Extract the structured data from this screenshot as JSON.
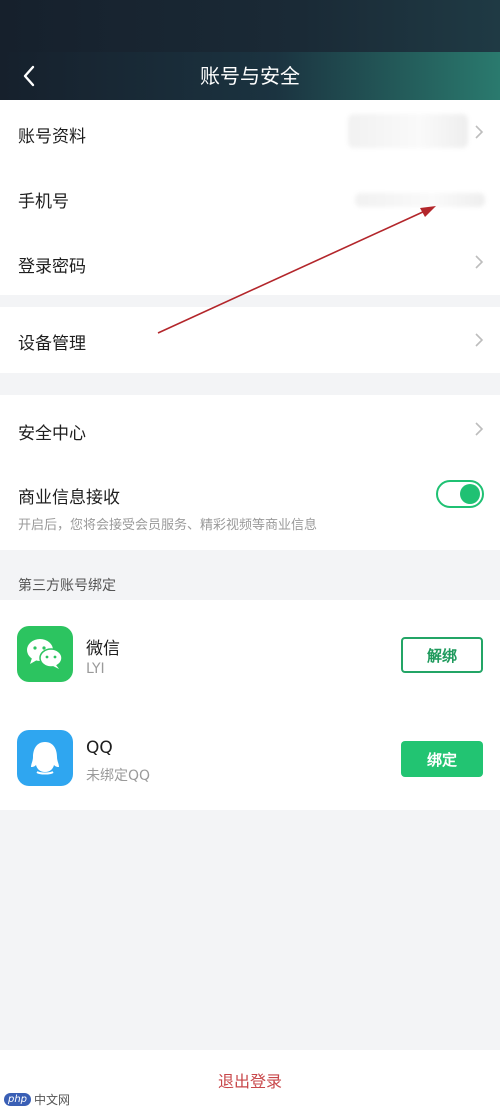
{
  "header": {
    "title": "账号与安全"
  },
  "account_group": {
    "items": [
      {
        "label": "账号资料"
      },
      {
        "label": "手机号"
      },
      {
        "label": "登录密码"
      }
    ]
  },
  "device_group": {
    "label": "设备管理"
  },
  "security_group": {
    "security_center": "安全中心",
    "business_info": {
      "label": "商业信息接收",
      "description": "开启后，您将会接受会员服务、精彩视频等商业信息",
      "enabled": true
    }
  },
  "third_party": {
    "header": "第三方账号绑定",
    "accounts": [
      {
        "name": "微信",
        "subtitle": "LYI",
        "action": "解绑"
      },
      {
        "name": "QQ",
        "subtitle": "未绑定QQ",
        "action": "绑定"
      }
    ]
  },
  "footer": {
    "logout": "退出登录",
    "watermark_badge": "php",
    "watermark_text": "中文网"
  },
  "colors": {
    "accent_green": "#22c472",
    "logout_red": "#c8474a",
    "annotation_arrow": "#b3262b"
  },
  "icons": [
    "back-arrow-icon",
    "chevron-right-icon",
    "wechat-icon",
    "qq-icon"
  ]
}
